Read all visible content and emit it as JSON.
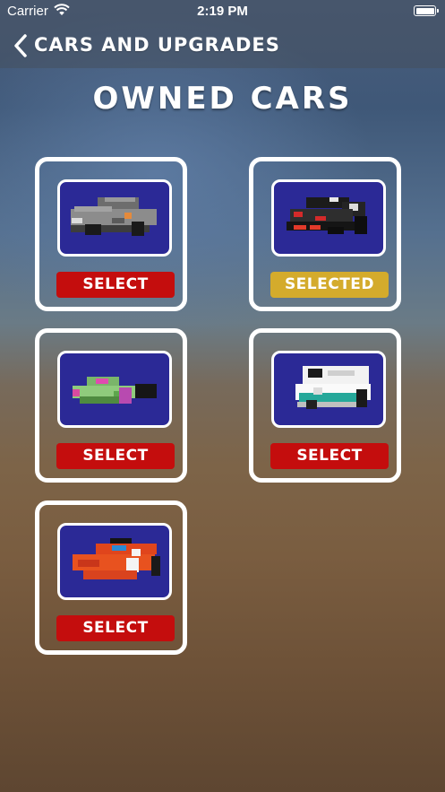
{
  "status_bar": {
    "carrier": "Carrier",
    "time": "2:19 PM",
    "wifi_icon": "wifi-icon",
    "battery_icon": "battery-icon"
  },
  "nav": {
    "back_icon": "chevron-left-icon",
    "title": "CARS AND UPGRADES"
  },
  "section_title": "OWNED CARS",
  "colors": {
    "card_border": "#ffffff",
    "car_thumbnail_bg": "#2b2996",
    "select_button": "#c40d0d",
    "selected_button": "#d4ab2c"
  },
  "cars": [
    {
      "thumbnail": "gray-voxel-car-image",
      "button_label": "SELECT",
      "selected": false
    },
    {
      "thumbnail": "black-red-voxel-car-image",
      "button_label": "SELECTED",
      "selected": true
    },
    {
      "thumbnail": "green-magenta-voxel-car-image",
      "button_label": "SELECT",
      "selected": false
    },
    {
      "thumbnail": "white-teal-voxel-van-image",
      "button_label": "SELECT",
      "selected": false
    },
    {
      "thumbnail": "orange-red-voxel-car-image",
      "button_label": "SELECT",
      "selected": false
    }
  ]
}
